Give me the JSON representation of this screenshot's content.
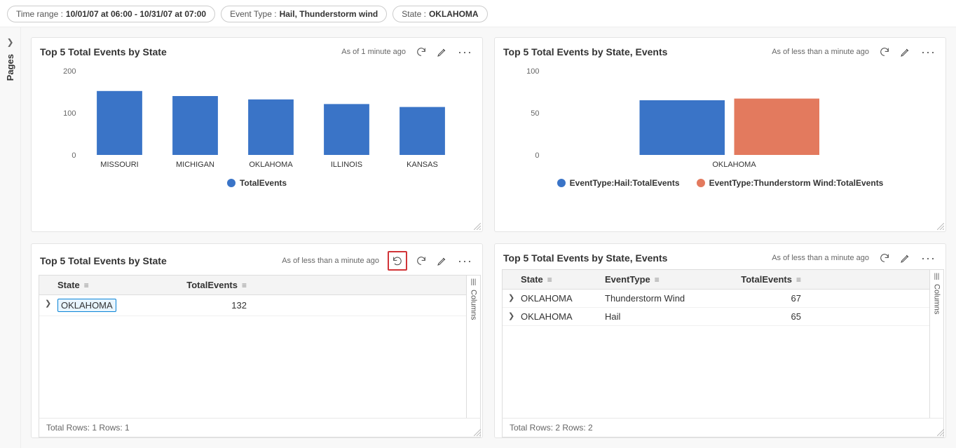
{
  "filters": {
    "timeRange": {
      "label": "Time range :",
      "value": "10/01/07 at 06:00 - 10/31/07 at 07:00"
    },
    "eventType": {
      "label": "Event Type :",
      "value": "Hail, Thunderstorm wind"
    },
    "state": {
      "label": "State :",
      "value": "OKLAHOMA"
    }
  },
  "sideRail": {
    "pagesLabel": "Pages"
  },
  "colors": {
    "blue": "#3a74c7",
    "orange": "#e37a5e"
  },
  "panel1": {
    "title": "Top 5 Total Events by State",
    "timestamp": "As of 1 minute ago",
    "legend": [
      {
        "name": "TotalEvents",
        "color": "#3a74c7"
      }
    ],
    "chart_data": {
      "type": "bar",
      "categories": [
        "MISSOURI",
        "MICHIGAN",
        "OKLAHOMA",
        "ILLINOIS",
        "KANSAS"
      ],
      "values": [
        152,
        140,
        132,
        121,
        114
      ],
      "ylim": [
        0,
        200
      ],
      "yticks": [
        0,
        100,
        200
      ]
    }
  },
  "panel2": {
    "title": "Top 5 Total Events by State, Events",
    "timestamp": "As of less than a minute ago",
    "legend": [
      {
        "name": "EventType:Hail:TotalEvents",
        "color": "#3a74c7"
      },
      {
        "name": "EventType:Thunderstorm Wind:TotalEvents",
        "color": "#e37a5e"
      }
    ],
    "chart_data": {
      "type": "bar",
      "categories": [
        "OKLAHOMA"
      ],
      "series": [
        {
          "name": "Hail",
          "values": [
            65
          ]
        },
        {
          "name": "Thunderstorm Wind",
          "values": [
            67
          ]
        }
      ],
      "ylim": [
        0,
        100
      ],
      "yticks": [
        0,
        50,
        100
      ]
    }
  },
  "panel3": {
    "title": "Top 5 Total Events by State",
    "timestamp": "As of less than a minute ago",
    "columns": [
      "State",
      "TotalEvents"
    ],
    "columnsRailLabel": "Columns",
    "rows": [
      {
        "State": "OKLAHOMA",
        "TotalEvents": 132
      }
    ],
    "footer": "Total Rows: 1  Rows: 1"
  },
  "panel4": {
    "title": "Top 5 Total Events by State, Events",
    "timestamp": "As of less than a minute ago",
    "columns": [
      "State",
      "EventType",
      "TotalEvents"
    ],
    "columnsRailLabel": "Columns",
    "rows": [
      {
        "State": "OKLAHOMA",
        "EventType": "Thunderstorm Wind",
        "TotalEvents": 67
      },
      {
        "State": "OKLAHOMA",
        "EventType": "Hail",
        "TotalEvents": 65
      }
    ],
    "footer": "Total Rows: 2  Rows: 2"
  }
}
